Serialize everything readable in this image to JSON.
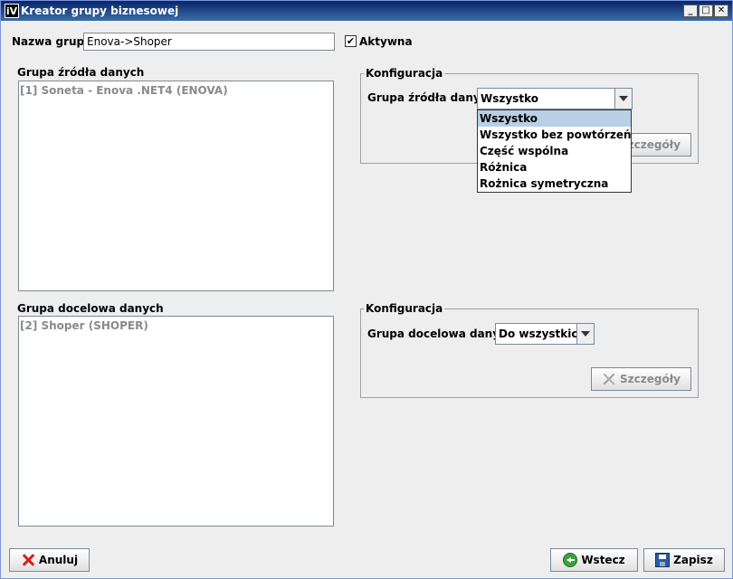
{
  "window": {
    "title": "Kreator grupy biznesowej",
    "icon_text": "iV",
    "controls": {
      "minimize": "_",
      "maximize": "□",
      "close": "✕"
    }
  },
  "group_name": {
    "label": "Nazwa grupy",
    "value": "Enova->Shoper"
  },
  "active": {
    "label": "Aktywna",
    "checked": true,
    "check_glyph": "✔"
  },
  "source": {
    "list_label": "Grupa źródła danych",
    "items": [
      "[1] Soneta - Enova .NET4 (ENOVA)"
    ],
    "config": {
      "title": "Konfiguracja",
      "field_label": "Grupa źródła danych",
      "selected": "Wszystko",
      "options": [
        "Wszystko",
        "Wszystko bez powtórzeń",
        "Część wspólna",
        "Różnica",
        "Rożnica symetryczna"
      ],
      "details_button": "Szczegóły"
    }
  },
  "target": {
    "list_label": "Grupa docelowa danych",
    "items": [
      "[2] Shoper (SHOPER)"
    ],
    "config": {
      "title": "Konfiguracja",
      "field_label": "Grupa docelowa danych",
      "selected": "Do wszystkich",
      "details_button": "Szczegóły"
    }
  },
  "footer": {
    "cancel": "Anuluj",
    "back": "Wstecz",
    "save": "Zapisz"
  }
}
